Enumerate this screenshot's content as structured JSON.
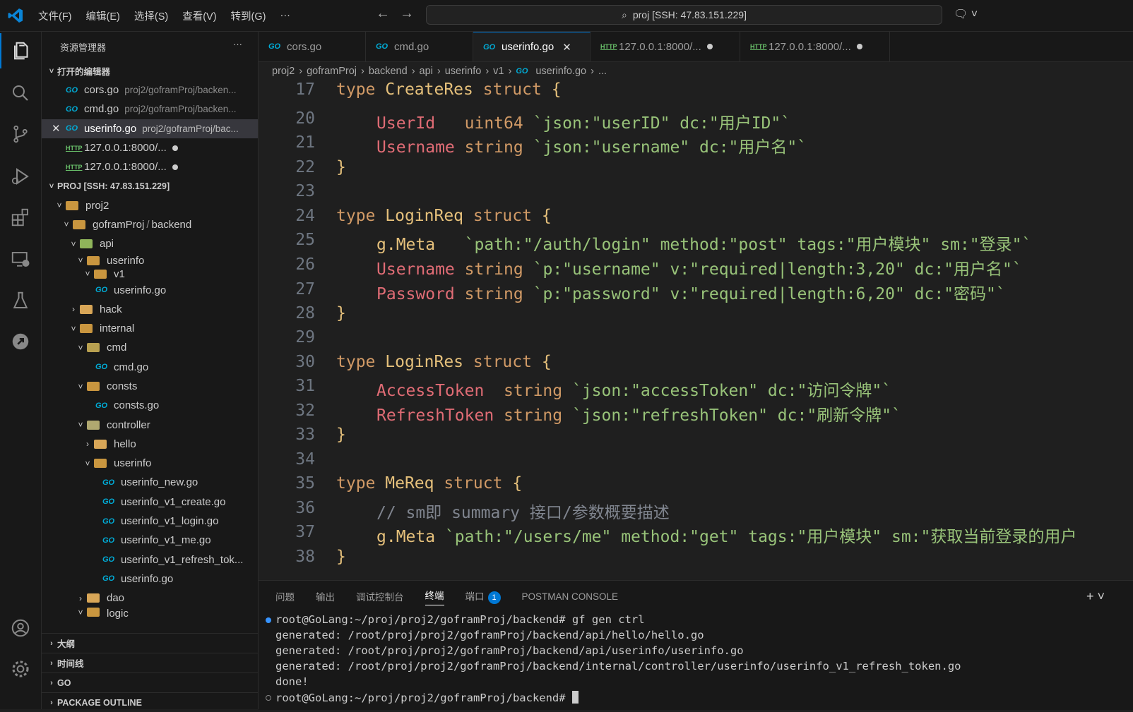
{
  "menu": [
    "文件(F)",
    "编辑(E)",
    "选择(S)",
    "查看(V)",
    "转到(G)",
    "···"
  ],
  "search": {
    "text": "proj [SSH: 47.83.151.229]"
  },
  "sidebar": {
    "title": "资源管理器",
    "open_editors_title": "打开的编辑器",
    "open_editors": [
      {
        "name": "cors.go",
        "path": "proj2/goframProj/backen..."
      },
      {
        "name": "cmd.go",
        "path": "proj2/goframProj/backen..."
      },
      {
        "name": "userinfo.go",
        "path": "proj2/goframProj/bac..."
      },
      {
        "name": "127.0.0.1:8000/..."
      },
      {
        "name": "127.0.0.1:8000/..."
      }
    ],
    "project_title": "PROJ [SSH: 47.83.151.229]",
    "tree": {
      "proj2": "proj2",
      "gofram": "goframProj",
      "backend": "backend",
      "api": "api",
      "userinfo": "userinfo",
      "v1": "v1",
      "userinfo_go": "userinfo.go",
      "hack": "hack",
      "internal": "internal",
      "cmd": "cmd",
      "cmd_go": "cmd.go",
      "consts": "consts",
      "consts_go": "consts.go",
      "controller": "controller",
      "hello": "hello",
      "userinfo2": "userinfo",
      "f1": "userinfo_new.go",
      "f2": "userinfo_v1_create.go",
      "f3": "userinfo_v1_login.go",
      "f4": "userinfo_v1_me.go",
      "f5": "userinfo_v1_refresh_tok...",
      "f6": "userinfo.go",
      "dao": "dao",
      "logic": "logic"
    },
    "bottom_sections": [
      "大纲",
      "时间线",
      "GO",
      "PACKAGE OUTLINE"
    ]
  },
  "tabs": [
    {
      "label": "cors.go"
    },
    {
      "label": "cmd.go"
    },
    {
      "label": "userinfo.go"
    },
    {
      "label": "127.0.0.1:8000/..."
    },
    {
      "label": "127.0.0.1:8000/..."
    }
  ],
  "breadcrumb": [
    "proj2",
    "goframProj",
    "backend",
    "api",
    "userinfo",
    "v1",
    "userinfo.go",
    "..."
  ],
  "editor": {
    "line_numbers": [
      "17",
      "20",
      "21",
      "22",
      "23",
      "24",
      "25",
      "26",
      "27",
      "28",
      "29",
      "30",
      "31",
      "32",
      "33",
      "34",
      "35",
      "36",
      "37",
      "38"
    ],
    "l17": {
      "a": "type",
      "b": "CreateRes",
      "c": "struct",
      "d": "{"
    },
    "l20": {
      "a": "UserId",
      "b": "uint64",
      "c": "`json:\"userID\" dc:\"用户ID\"`"
    },
    "l21": {
      "a": "Username",
      "b": "string",
      "c": "`json:\"username\" dc:\"用户名\"`"
    },
    "l22": "}",
    "l24": {
      "a": "type",
      "b": "LoginReq",
      "c": "struct",
      "d": "{"
    },
    "l25": {
      "a": "g.Meta",
      "b": "`path:\"/auth/login\" method:\"post\" tags:\"用户模块\" sm:\"登录\"`"
    },
    "l26": {
      "a": "Username",
      "b": "string",
      "c": "`p:\"username\" v:\"required|length:3,20\" dc:\"用户名\"`"
    },
    "l27": {
      "a": "Password",
      "b": "string",
      "c": "`p:\"password\" v:\"required|length:6,20\" dc:\"密码\"`"
    },
    "l28": "}",
    "l30": {
      "a": "type",
      "b": "LoginRes",
      "c": "struct",
      "d": "{"
    },
    "l31": {
      "a": "AccessToken",
      "b": "string",
      "c": "`json:\"accessToken\" dc:\"访问令牌\"`"
    },
    "l32": {
      "a": "RefreshToken",
      "b": "string",
      "c": "`json:\"refreshToken\" dc:\"刷新令牌\"`"
    },
    "l33": "}",
    "l35": {
      "a": "type",
      "b": "MeReq",
      "c": "struct",
      "d": "{"
    },
    "l36": "// sm即 summary 接口/参数概要描述",
    "l37": {
      "a": "g.Meta",
      "b": "`path:\"/users/me\" method:\"get\" tags:\"用户模块\" sm:\"获取当前登录的用户"
    },
    "l38": "}"
  },
  "panel": {
    "tabs": [
      "问题",
      "输出",
      "调试控制台",
      "终端",
      "端口",
      "POSTMAN CONSOLE"
    ],
    "ports_badge": "1",
    "terminal": [
      "root@GoLang:~/proj/proj2/goframProj/backend# gf gen ctrl",
      "generated: /root/proj/proj2/goframProj/backend/api/hello/hello.go",
      "generated: /root/proj/proj2/goframProj/backend/api/userinfo/userinfo.go",
      "generated: /root/proj/proj2/goframProj/backend/internal/controller/userinfo/userinfo_v1_refresh_token.go",
      "done!",
      "root@GoLang:~/proj/proj2/goframProj/backend# "
    ]
  },
  "colors": {
    "accent": "#0078d4",
    "go_icon": "#00acd7",
    "keyword": "#d19a66",
    "string": "#98c379",
    "field": "#e06c75",
    "type": "#e5c07b"
  }
}
